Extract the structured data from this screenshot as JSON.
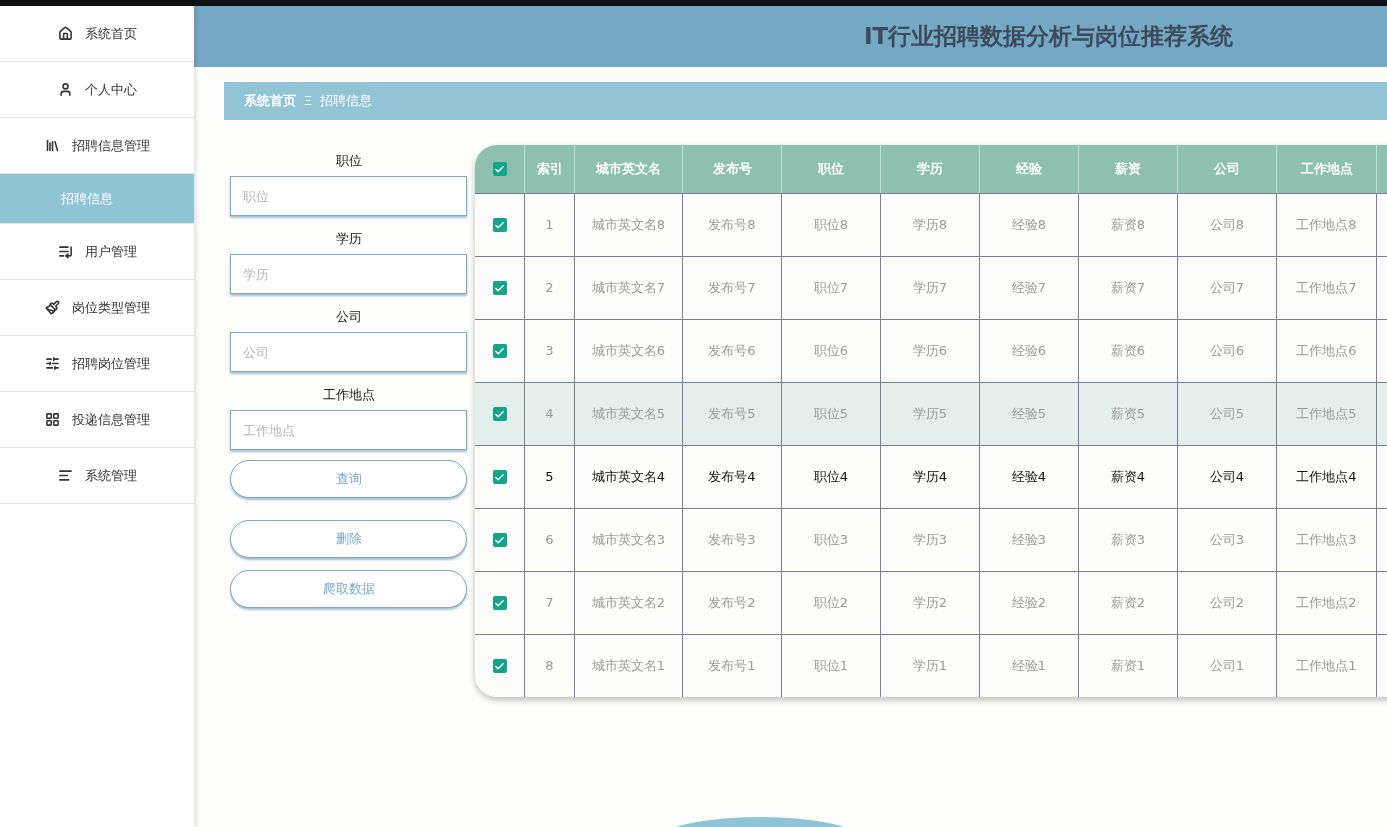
{
  "sidebar": {
    "items": [
      {
        "label": "系统首页",
        "selected": false
      },
      {
        "label": "个人中心",
        "selected": false
      },
      {
        "label": "招聘信息管理",
        "selected": false
      },
      {
        "label": "招聘信息",
        "selected": true
      },
      {
        "label": "用户管理",
        "selected": false
      },
      {
        "label": "岗位类型管理",
        "selected": false
      },
      {
        "label": "招聘岗位管理",
        "selected": false
      },
      {
        "label": "投递信息管理",
        "selected": false
      },
      {
        "label": "系统管理",
        "selected": false
      }
    ]
  },
  "header": {
    "title": "IT行业招聘数据分析与岗位推荐系统"
  },
  "breadcrumb": {
    "items": [
      "系统首页",
      "招聘信息"
    ],
    "separator": "Ξ"
  },
  "search_form": {
    "fields": [
      {
        "label": "职位",
        "placeholder": "职位"
      },
      {
        "label": "学历",
        "placeholder": "学历"
      },
      {
        "label": "公司",
        "placeholder": "公司"
      },
      {
        "label": "工作地点",
        "placeholder": "工作地点"
      }
    ],
    "buttons": [
      "查询",
      "删除",
      "爬取数据"
    ]
  },
  "table": {
    "all_checked": true,
    "columns": [
      "索引",
      "城市英文名",
      "发布号",
      "职位",
      "学历",
      "经验",
      "薪资",
      "公司",
      "工作地点"
    ],
    "rows": [
      {
        "checked": true,
        "highlighted": false,
        "hovered": false,
        "cells": [
          "1",
          "城市英文名8",
          "发布号8",
          "职位8",
          "学历8",
          "经验8",
          "薪资8",
          "公司8",
          "工作地点8"
        ]
      },
      {
        "checked": true,
        "highlighted": false,
        "hovered": false,
        "cells": [
          "2",
          "城市英文名7",
          "发布号7",
          "职位7",
          "学历7",
          "经验7",
          "薪资7",
          "公司7",
          "工作地点7"
        ]
      },
      {
        "checked": true,
        "highlighted": false,
        "hovered": false,
        "cells": [
          "3",
          "城市英文名6",
          "发布号6",
          "职位6",
          "学历6",
          "经验6",
          "薪资6",
          "公司6",
          "工作地点6"
        ]
      },
      {
        "checked": true,
        "highlighted": true,
        "hovered": false,
        "cells": [
          "4",
          "城市英文名5",
          "发布号5",
          "职位5",
          "学历5",
          "经验5",
          "薪资5",
          "公司5",
          "工作地点5"
        ]
      },
      {
        "checked": true,
        "highlighted": false,
        "hovered": true,
        "cells": [
          "5",
          "城市英文名4",
          "发布号4",
          "职位4",
          "学历4",
          "经验4",
          "薪资4",
          "公司4",
          "工作地点4"
        ]
      },
      {
        "checked": true,
        "highlighted": false,
        "hovered": false,
        "cells": [
          "6",
          "城市英文名3",
          "发布号3",
          "职位3",
          "学历3",
          "经验3",
          "薪资3",
          "公司3",
          "工作地点3"
        ]
      },
      {
        "checked": true,
        "highlighted": false,
        "hovered": false,
        "cells": [
          "7",
          "城市英文名2",
          "发布号2",
          "职位2",
          "学历2",
          "经验2",
          "薪资2",
          "公司2",
          "工作地点2"
        ]
      },
      {
        "checked": true,
        "highlighted": false,
        "hovered": false,
        "cells": [
          "8",
          "城市英文名1",
          "发布号1",
          "职位1",
          "学历1",
          "经验1",
          "薪资1",
          "公司1",
          "工作地点1"
        ]
      }
    ]
  }
}
